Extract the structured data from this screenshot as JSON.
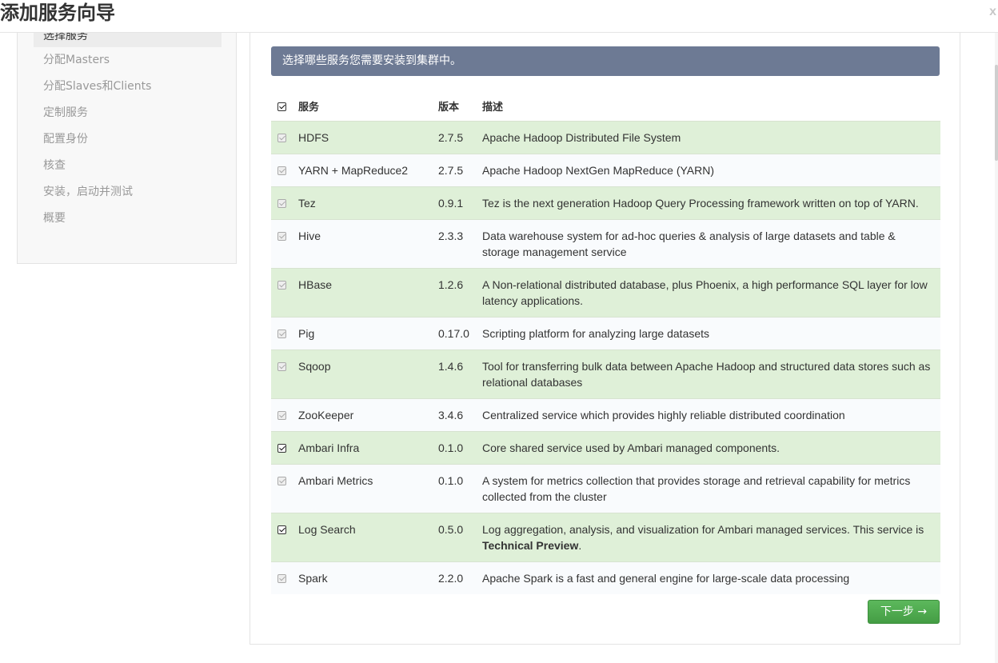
{
  "window": {
    "title": "添加服务向导",
    "close_label": "x"
  },
  "sidebar": {
    "items": [
      {
        "label": "选择服务",
        "active": true
      },
      {
        "label": "分配Masters",
        "active": false
      },
      {
        "label": "分配Slaves和Clients",
        "active": false
      },
      {
        "label": "定制服务",
        "active": false
      },
      {
        "label": "配置身份",
        "active": false
      },
      {
        "label": "核查",
        "active": false
      },
      {
        "label": "安装，启动并测试",
        "active": false
      },
      {
        "label": "概要",
        "active": false
      }
    ]
  },
  "main": {
    "alert_text": "选择哪些服务您需要安装到集群中。",
    "table": {
      "headers": {
        "service": "服务",
        "version": "版本",
        "description": "描述"
      },
      "rows": [
        {
          "name": "HDFS",
          "version": "2.7.5",
          "description": "Apache Hadoop Distributed File System",
          "checked": true,
          "enabled": false
        },
        {
          "name": "YARN + MapReduce2",
          "version": "2.7.5",
          "description": "Apache Hadoop NextGen MapReduce (YARN)",
          "checked": true,
          "enabled": false
        },
        {
          "name": "Tez",
          "version": "0.9.1",
          "description": "Tez is the next generation Hadoop Query Processing framework written on top of YARN.",
          "checked": true,
          "enabled": false
        },
        {
          "name": "Hive",
          "version": "2.3.3",
          "description": "Data warehouse system for ad-hoc queries & analysis of large datasets and table & storage management service",
          "checked": true,
          "enabled": false
        },
        {
          "name": "HBase",
          "version": "1.2.6",
          "description": "A Non-relational distributed database, plus Phoenix, a high performance SQL layer for low latency applications.",
          "checked": true,
          "enabled": false
        },
        {
          "name": "Pig",
          "version": "0.17.0",
          "description": "Scripting platform for analyzing large datasets",
          "checked": true,
          "enabled": false
        },
        {
          "name": "Sqoop",
          "version": "1.4.6",
          "description": "Tool for transferring bulk data between Apache Hadoop and structured data stores such as relational databases",
          "checked": true,
          "enabled": false
        },
        {
          "name": "ZooKeeper",
          "version": "3.4.6",
          "description": "Centralized service which provides highly reliable distributed coordination",
          "checked": true,
          "enabled": false
        },
        {
          "name": "Ambari Infra",
          "version": "0.1.0",
          "description": "Core shared service used by Ambari managed components.",
          "checked": true,
          "enabled": true
        },
        {
          "name": "Ambari Metrics",
          "version": "0.1.0",
          "description": "A system for metrics collection that provides storage and retrieval capability for metrics collected from the cluster",
          "checked": true,
          "enabled": false
        },
        {
          "name": "Log Search",
          "version": "0.5.0",
          "description": "Log aggregation, analysis, and visualization for Ambari managed services. This service is ",
          "description_bold": "Technical Preview",
          "description_suffix": ".",
          "checked": true,
          "enabled": true
        },
        {
          "name": "Spark",
          "version": "2.2.0",
          "description": "Apache Spark is a fast and general engine for large-scale data processing",
          "checked": true,
          "enabled": false
        }
      ]
    },
    "next_button_label": "下一步 →"
  }
}
